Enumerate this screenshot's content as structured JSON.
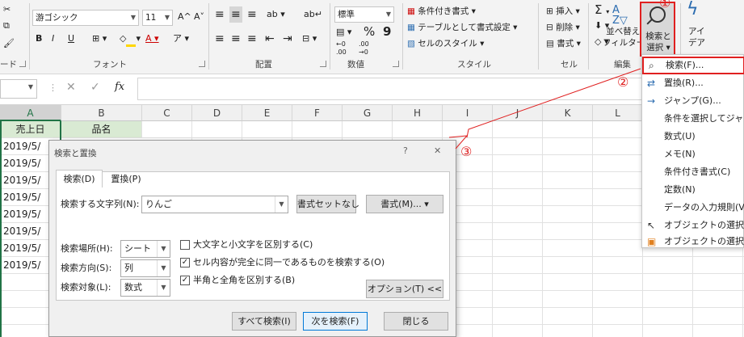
{
  "ribbon": {
    "clipboard_label": "ード",
    "font_group": {
      "font_name": "游ゴシック",
      "font_size": "11",
      "grow": "A^",
      "shrink": "A˅",
      "bold": "B",
      "italic": "I",
      "underline": "U",
      "label": "フォント"
    },
    "alignment_label": "配置",
    "number_group": {
      "format": "標準",
      "percent": "%",
      "comma": "9",
      "label": "数値"
    },
    "style_group": {
      "conditional": "条件付き書式",
      "table": "テーブルとして書式設定",
      "cell_style": "セルのスタイル",
      "label": "スタイル"
    },
    "cells_group": {
      "insert": "挿入",
      "delete": "削除",
      "format": "書式",
      "label": "セル"
    },
    "editing_group": {
      "sort_filter_1": "並べ替えと",
      "sort_filter_2": "フィルター",
      "find_select_1": "検索と",
      "find_select_2": "選択",
      "label": "編集",
      "ideas_1": "アイ",
      "ideas_2": "デア"
    }
  },
  "formula_bar": {
    "fx": "fx",
    "cancel": "✕",
    "enter": "✓"
  },
  "sheet": {
    "columns": [
      "A",
      "B",
      "C",
      "D",
      "E",
      "F",
      "G",
      "H",
      "I",
      "J",
      "K",
      "L"
    ],
    "header_a": "売上日",
    "header_b": "品名",
    "dates": [
      "2019/5/",
      "2019/5/",
      "2019/5/",
      "2019/5/",
      "2019/5/",
      "2019/5/",
      "2019/5/",
      "2019/5/"
    ]
  },
  "dialog": {
    "title": "検索と置換",
    "help": "?",
    "close": "✕",
    "tab_find": "検索(D)",
    "tab_replace": "置換(P)",
    "search_label": "検索する文字列(N):",
    "search_value": "りんご",
    "no_format": "書式セットなし",
    "format_btn": "書式(M)...",
    "scope_label": "検索場所(H):",
    "scope_value": "シート",
    "direction_label": "検索方向(S):",
    "direction_value": "列",
    "target_label": "検索対象(L):",
    "target_value": "数式",
    "opt_case": "大文字と小文字を区別する(C)",
    "opt_case_checked": false,
    "opt_whole": "セル内容が完全に同一であるものを検索する(O)",
    "opt_whole_checked": true,
    "opt_width": "半角と全角を区別する(B)",
    "opt_width_checked": true,
    "options_btn": "オプション(T) <<",
    "find_all": "すべて検索(I)",
    "find_next": "次を検索(F)",
    "close_btn": "閉じる"
  },
  "menu": {
    "items": [
      {
        "label": "検索(F)...",
        "icon": "search-icon"
      },
      {
        "label": "置換(R)...",
        "icon": "replace-icon"
      },
      {
        "label": "ジャンプ(G)...",
        "icon": "arrow-right-icon"
      },
      {
        "label": "条件を選択してジャンプ(S)...",
        "icon": ""
      },
      {
        "label": "数式(U)",
        "icon": ""
      },
      {
        "label": "メモ(N)",
        "icon": ""
      },
      {
        "label": "条件付き書式(C)",
        "icon": ""
      },
      {
        "label": "定数(N)",
        "icon": ""
      },
      {
        "label": "データの入力規則(V)",
        "icon": ""
      },
      {
        "label": "オブジェクトの選択(O)",
        "icon": "cursor-icon"
      },
      {
        "label": "オブジェクトの選択と表示(P)...",
        "icon": "selection-pane-icon"
      }
    ]
  },
  "annotations": {
    "one": "①",
    "two": "②",
    "three": "③"
  },
  "colors": {
    "accent_red": "#e02020",
    "header_green": "#217346",
    "icon_blue": "#2b6cb0"
  }
}
